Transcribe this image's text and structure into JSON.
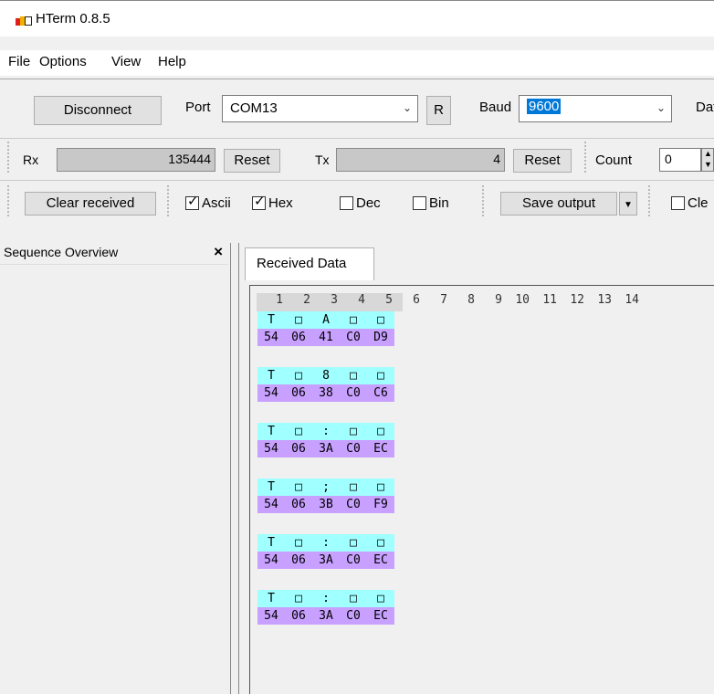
{
  "window": {
    "title": "HTerm 0.8.5"
  },
  "menu": [
    "File",
    "Options",
    "View",
    "Help"
  ],
  "connection": {
    "disconnect_label": "Disconnect",
    "port_label": "Port",
    "port_value": "COM13",
    "r_label": "R",
    "baud_label": "Baud",
    "baud_value": "9600",
    "data_label": "Data"
  },
  "counters": {
    "rx_label": "Rx",
    "rx_value": "135444",
    "rx_reset": "Reset",
    "tx_label": "Tx",
    "tx_value": "4",
    "tx_reset": "Reset",
    "count_label": "Count",
    "count_value": "0"
  },
  "display": {
    "clear_received": "Clear received",
    "ascii_label": "Ascii",
    "hex_label": "Hex",
    "dec_label": "Dec",
    "bin_label": "Bin",
    "ascii_checked": true,
    "hex_checked": true,
    "dec_checked": false,
    "bin_checked": false,
    "save_output": "Save output",
    "clear_cut": "Cle"
  },
  "sequence_panel": {
    "title": "Sequence Overview",
    "close": "×"
  },
  "received_tab": {
    "label": "Received Data"
  },
  "columns": [
    "1",
    "2",
    "3",
    "4",
    "5",
    "6",
    "7",
    "8",
    "9",
    "10",
    "11",
    "12",
    "13",
    "14"
  ],
  "rows": [
    {
      "ascii": [
        "T",
        "□",
        "A",
        "□",
        "□"
      ],
      "hex": [
        "54",
        "06",
        "41",
        "C0",
        "D9"
      ]
    },
    {
      "ascii": [
        "T",
        "□",
        "8",
        "□",
        "□"
      ],
      "hex": [
        "54",
        "06",
        "38",
        "C0",
        "C6"
      ]
    },
    {
      "ascii": [
        "T",
        "□",
        ":",
        "□",
        "□"
      ],
      "hex": [
        "54",
        "06",
        "3A",
        "C0",
        "EC"
      ]
    },
    {
      "ascii": [
        "T",
        "□",
        ";",
        "□",
        "□"
      ],
      "hex": [
        "54",
        "06",
        "3B",
        "C0",
        "F9"
      ]
    },
    {
      "ascii": [
        "T",
        "□",
        ":",
        "□",
        "□"
      ],
      "hex": [
        "54",
        "06",
        "3A",
        "C0",
        "EC"
      ]
    },
    {
      "ascii": [
        "T",
        "□",
        ":",
        "□",
        "□"
      ],
      "hex": [
        "54",
        "06",
        "3A",
        "C0",
        "EC"
      ]
    }
  ]
}
